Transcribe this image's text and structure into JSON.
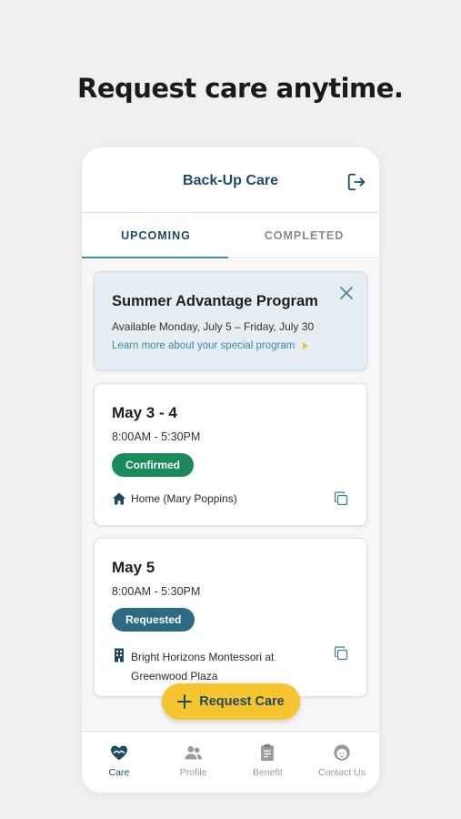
{
  "headline": "Request care anytime.",
  "app": {
    "title": "Back-Up Care",
    "logout_icon": "logout-icon"
  },
  "tabs": [
    {
      "label": "UPCOMING",
      "active": true
    },
    {
      "label": "COMPLETED",
      "active": false
    }
  ],
  "promo": {
    "title": "Summer Advantage Program",
    "dates": "Available Monday, July 5 – Friday, July 30",
    "link": "Learn more about your special program",
    "close_icon": "close-icon"
  },
  "bookings": [
    {
      "date": "May 3 - 4",
      "time": "8:00AM - 5:30PM",
      "status": "Confirmed",
      "status_color": "#1a8a5a",
      "location_icon": "home-icon",
      "location": "Home (Mary Poppins)"
    },
    {
      "date": "May 5",
      "time": "8:00AM - 5:30PM",
      "status": "Requested",
      "status_color": "#2b6b84",
      "location_icon": "building-icon",
      "location_line1": "Bright Horizons Montessori at",
      "location_line2": "Greenwood Plaza"
    }
  ],
  "fab": {
    "label": "Request Care",
    "icon": "plus-icon"
  },
  "nav": [
    {
      "label": "Care",
      "icon": "heart-hands-icon",
      "active": true
    },
    {
      "label": "Profile",
      "icon": "people-icon",
      "active": false
    },
    {
      "label": "Benefit",
      "icon": "clipboard-icon",
      "active": false
    },
    {
      "label": "Contact Us",
      "icon": "person-icon",
      "active": false
    }
  ],
  "colors": {
    "primary": "#1f4a63",
    "accent": "#f5c42f",
    "link": "#3a8aa0"
  }
}
